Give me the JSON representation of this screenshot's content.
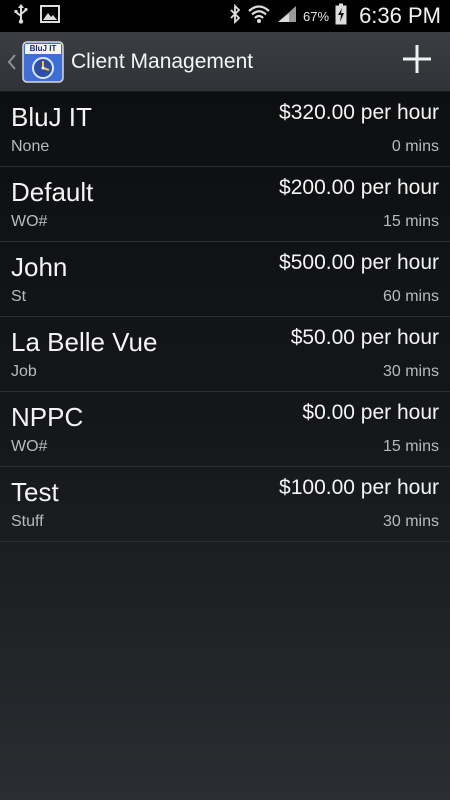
{
  "status_bar": {
    "icons_left": [
      "usb-icon",
      "image-icon"
    ],
    "icons_right": [
      "bluetooth-icon",
      "wifi-icon",
      "signal-icon",
      "battery-charging-icon"
    ],
    "battery_percent": "67%",
    "time": "6:36 PM"
  },
  "action_bar": {
    "title": "Client Management",
    "app_icon_label": "BluJ IT",
    "add_icon": "plus-icon",
    "up_icon": "chevron-left-icon"
  },
  "clients": [
    {
      "name": "BluJ IT",
      "rate": "$320.00 per hour",
      "sub": "None",
      "rounding": "0 mins"
    },
    {
      "name": "Default",
      "rate": "$200.00 per hour",
      "sub": "WO#",
      "rounding": "15 mins"
    },
    {
      "name": "John",
      "rate": "$500.00 per hour",
      "sub": "St",
      "rounding": "60 mins"
    },
    {
      "name": "La Belle Vue",
      "rate": "$50.00 per hour",
      "sub": "Job",
      "rounding": "30 mins"
    },
    {
      "name": "NPPC",
      "rate": "$0.00 per hour",
      "sub": "WO#",
      "rounding": "15 mins"
    },
    {
      "name": "Test",
      "rate": "$100.00 per hour",
      "sub": "Stuff",
      "rounding": "30 mins"
    }
  ],
  "colors": {
    "accent_blue": "#3f6fd6",
    "background": "#0b0c0e",
    "action_bar": "#35383c"
  }
}
